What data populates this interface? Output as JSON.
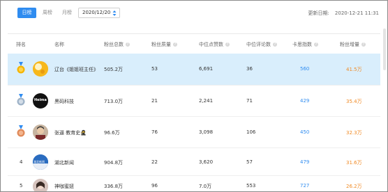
{
  "tabs": {
    "daily": "日榜",
    "weekly": "周榜",
    "monthly": "月榜"
  },
  "date": {
    "value": "2020/12/20"
  },
  "update": {
    "label": "更新日期:",
    "value": "2020-12-21 11:31"
  },
  "header": {
    "rank": "排名",
    "name": "名称",
    "fans": "粉丝总数",
    "quality": "粉丝质量",
    "likes": "中位点赞数",
    "comments": "中位评论数",
    "kasi": "卡思指数",
    "growth": "粉丝增量"
  },
  "rows": [
    {
      "rank": "",
      "name": "辽台《姐姐班主任》",
      "fans": "505.2万",
      "quality": "53",
      "likes": "6,691",
      "comments": "36",
      "kasi": "560",
      "growth": "41.5万",
      "avatar_label": ""
    },
    {
      "rank": "",
      "name": "黑码科技",
      "fans": "713.0万",
      "quality": "21",
      "likes": "2,241",
      "comments": "71",
      "kasi": "429",
      "growth": "35.4万",
      "avatar_label": "Heima"
    },
    {
      "rank": "",
      "name": "张逼 教育史🥷",
      "fans": "96.6万",
      "quality": "76",
      "likes": "3,098",
      "comments": "106",
      "kasi": "450",
      "growth": "32.3万",
      "avatar_label": ""
    },
    {
      "rank": "4",
      "name": "湖北新闻",
      "fans": "904.8万",
      "quality": "22",
      "likes": "3,620",
      "comments": "57",
      "kasi": "479",
      "growth": "31.6万",
      "avatar_label": "湖北新闻"
    },
    {
      "rank": "5",
      "name": "神咖蜜妞",
      "fans": "336.8万",
      "quality": "96",
      "likes": "7.0万",
      "comments": "553",
      "kasi": "727",
      "growth": "26.2万",
      "avatar_label": ""
    }
  ],
  "colors": {
    "accent": "#2f8cf0",
    "orange": "#f08a24",
    "highlight": "#d9eefc"
  }
}
